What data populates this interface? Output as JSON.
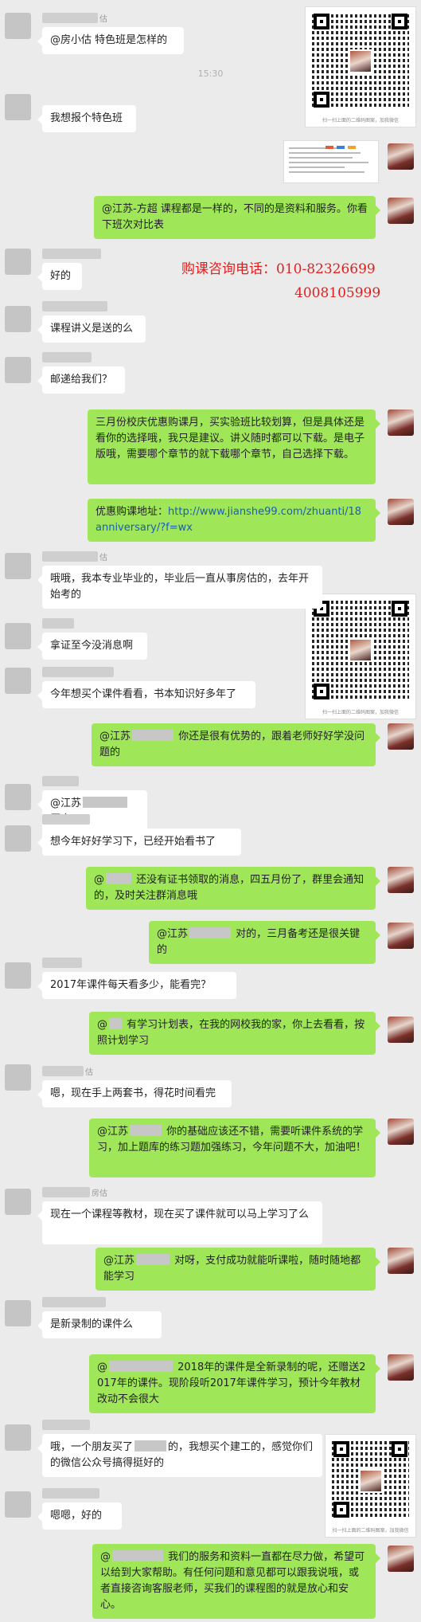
{
  "timestamp": "15:30",
  "contact_line": {
    "label": "购课咨询电话：010-82326699",
    "number2": "4008105999"
  },
  "qr_caption": "扫一扫上面的二维码图案，加我微信",
  "messages": [
    {
      "side": "left",
      "text": "@房小估 特色班是怎样的"
    },
    {
      "side": "left",
      "text": "我想报个特色班"
    },
    {
      "side": "right",
      "text": "@江苏-方超 课程都是一样的，不同的是资料和服务。你看下班次对比表"
    },
    {
      "side": "left",
      "text": "好的"
    },
    {
      "side": "left",
      "text": "课程讲义是送的么"
    },
    {
      "side": "left",
      "text": "邮递给我们？"
    },
    {
      "side": "right",
      "text": "三月份校庆优惠购课月，买实验班比较划算，但是具体还是看你的选择哦，我只是建议。讲义随时都可以下载。是电子版哦，需要哪个章节的就下载哪个章节，自己选择下载。"
    },
    {
      "side": "right",
      "prefix": "优惠购课地址：",
      "link": "http://www.jianshe99.com/zhuanti/18anniversary/?f=wx"
    },
    {
      "side": "left",
      "text": "哦哦，我本专业毕业的，毕业后一直从事房估的，去年开始考的"
    },
    {
      "side": "left",
      "text": "拿证至今没消息啊"
    },
    {
      "side": "left",
      "text": "今年想买个课件看看，书本知识好多年了"
    },
    {
      "side": "right",
      "pre": "@江苏",
      "post": " 你还是很有优势的，跟着老师好好学没问题的"
    },
    {
      "side": "left",
      "pre": "@江苏",
      "post": " 厉害"
    },
    {
      "side": "left",
      "text": "想今年好好学习下，已经开始看书了"
    },
    {
      "side": "right",
      "pre": "@",
      "post": " 还没有证书领取的消息，四五月份了，群里会通知的，及时关注群消息哦"
    },
    {
      "side": "right",
      "pre": "@江苏",
      "post": " 对的，三月备考还是很关键的"
    },
    {
      "side": "left",
      "text": "2017年课件每天看多少，能看完？"
    },
    {
      "side": "right",
      "pre": "@",
      "post": " 有学习计划表，在我的网校我的家，你上去看看，按照计划学习"
    },
    {
      "side": "left",
      "text": "嗯，现在手上两套书，得花时间看完"
    },
    {
      "side": "right",
      "pre": "@江苏",
      "post": " 你的基础应该还不错，需要听课件系统的学习，加上题库的练习题加强练习，今年问题不大，加油吧！"
    },
    {
      "side": "left",
      "text": "现在一个课程等教材，现在买了课件就可以马上学习了么"
    },
    {
      "side": "right",
      "pre": "@江苏",
      "post": " 对呀，支付成功就能听课啦，随时随地都能学习"
    },
    {
      "side": "left",
      "text": "是新录制的课件么"
    },
    {
      "side": "right",
      "pre": "@",
      "post": " 2018年的课件是全新录制的呢，还赠送2017年的课件。现阶段听2017年课件学习，预计今年教材改动不会很大"
    },
    {
      "side": "left",
      "pre": "哦，一个朋友买了",
      "post": "的，我想买个建工的，感觉你们的微信公众号搞得挺好的"
    },
    {
      "side": "left",
      "text": "嗯嗯，好的"
    },
    {
      "side": "right",
      "pre": "@",
      "post": " 我们的服务和资料一直都在尽力做，希望可以给到大家帮助。有任何问题和意见都可以跟我说哦，或者直接咨询客服老师，买我们的课程图的就是放心和安心。"
    }
  ],
  "nick_suffixes": {
    "s1": "估",
    "s2": "估",
    "s3": "房估"
  },
  "colors": {
    "bubble_right": "#9fe658",
    "bubble_left": "#ffffff",
    "background": "#ebebeb",
    "phone": "#e02020",
    "link": "#1b5fb4"
  }
}
